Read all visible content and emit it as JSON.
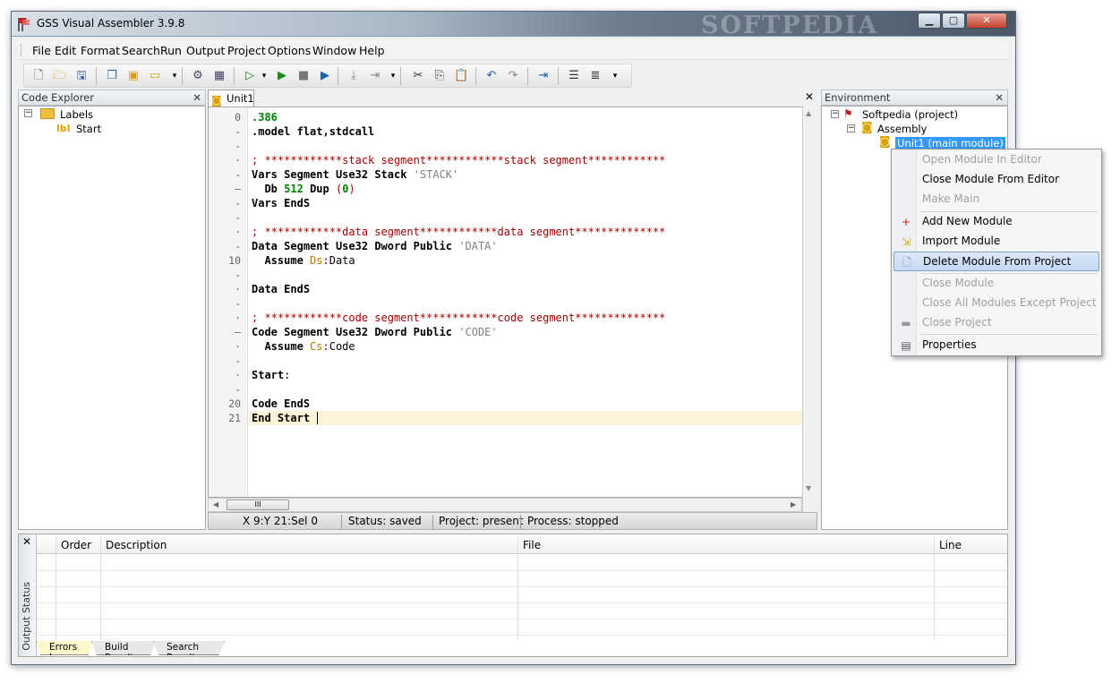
{
  "window": {
    "title": "GSS Visual Assembler 3.9.8",
    "watermark": "SOFTPEDIA",
    "min": "▁",
    "max": "▢",
    "close": "✕"
  },
  "menu": [
    "File",
    "Edit",
    "Format",
    "Search",
    "Run",
    "Output",
    "Project",
    "Options",
    "Window",
    "Help"
  ],
  "toolbar_icons": [
    "new-file-icon",
    "open-folder-icon",
    "save-icon",
    "save-all-icon",
    "open-project-icon",
    "folder-icon",
    "build-icon",
    "compile-icon",
    "run-icon",
    "run-dropdown-icon",
    "run-green-icon",
    "stop-icon",
    "step-icon",
    "step-into-icon",
    "step-over-icon",
    "cut-icon",
    "copy-icon",
    "paste-icon",
    "undo-icon",
    "redo-icon",
    "indent-icon",
    "align-icon",
    "list-icon"
  ],
  "code_explorer": {
    "title": "Code Explorer",
    "close": "✕",
    "root": "Labels",
    "child": "Start"
  },
  "editor": {
    "tab": "Unit1",
    "close": "✕",
    "line_numbers": [
      "0",
      "-",
      "-",
      "·",
      "-",
      "–",
      "-",
      "-",
      "·",
      "-",
      "10",
      "-",
      "·",
      "-",
      "·",
      "–",
      "·",
      "-",
      "·",
      "-",
      "20",
      "21"
    ],
    "lines": [
      ".386",
      ".model flat,stdcall",
      "",
      "; ************stack segment************stack segment************",
      "Vars Segment Use32 Stack 'STACK'",
      "  Db 512 Dup (0)",
      "Vars EndS",
      "",
      "; ************data segment************data segment**************",
      "Data Segment Use32 Dword Public 'DATA'",
      "  Assume Ds:Data",
      "",
      "Data EndS",
      "",
      "; ************code segment************code segment**************",
      "Code Segment Use32 Dword Public 'CODE'",
      "  Assume Cs:Code",
      "",
      "Start:",
      "",
      "Code EndS",
      "End Start"
    ],
    "scroll_thumb": "III"
  },
  "status": {
    "pos": "X 9:Y 21:Sel 0",
    "state": "Status: saved",
    "project": "Project: present",
    "process": "Process: stopped"
  },
  "environment": {
    "title": "Environment",
    "close": "✕",
    "project": "Softpedia (project)",
    "assembly": "Assembly",
    "module": "Unit1 (main module)"
  },
  "context_menu": [
    {
      "label": "Open Module In Editor",
      "disabled": true,
      "icon": ""
    },
    {
      "label": "Close Module From Editor",
      "disabled": false,
      "icon": ""
    },
    {
      "label": "Make Main",
      "disabled": true,
      "icon": ""
    },
    {
      "label": "Add New Module",
      "disabled": false,
      "icon": "add-module-icon"
    },
    {
      "label": "Import Module",
      "disabled": false,
      "icon": "import-module-icon"
    },
    {
      "label": "Delete Module From Project",
      "disabled": false,
      "icon": "delete-module-icon",
      "highlighted": true
    },
    {
      "label": "Close Module",
      "disabled": true,
      "icon": ""
    },
    {
      "label": "Close All Modules Except Project",
      "disabled": true,
      "icon": ""
    },
    {
      "label": "Close Project",
      "disabled": true,
      "icon": "close-project-icon"
    },
    {
      "label": "Properties",
      "disabled": false,
      "icon": "properties-icon"
    }
  ],
  "output": {
    "side_label": "Output Status",
    "close": "✕",
    "columns": [
      "Order",
      "Description",
      "File",
      "Line"
    ],
    "tabs": [
      "Errors Log",
      "Build Result",
      "Search Result"
    ]
  }
}
